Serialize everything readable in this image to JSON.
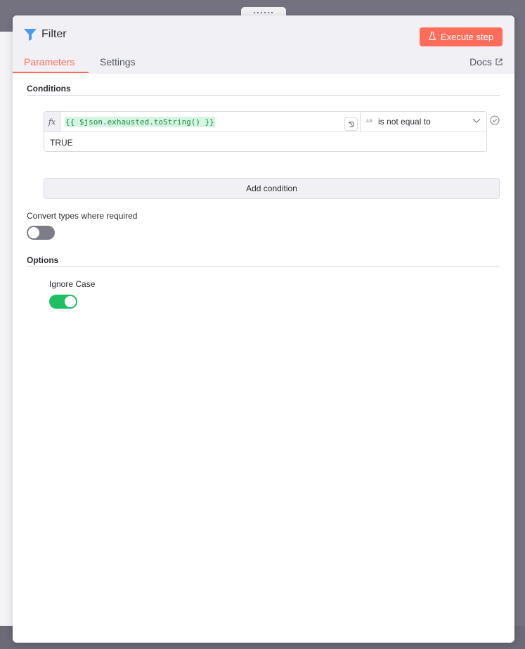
{
  "panel": {
    "title": "Filter",
    "execute_label": "Execute step",
    "tabs": [
      {
        "label": "Parameters",
        "active": true
      },
      {
        "label": "Settings",
        "active": false
      }
    ],
    "docs_label": "Docs"
  },
  "conditions": {
    "section_title": "Conditions",
    "items": [
      {
        "left_value": "{{ $json.exhausted.toString() }}",
        "type_badge": "AB",
        "operator": "is not equal to",
        "right_value": "TRUE"
      }
    ],
    "add_label": "Add condition"
  },
  "convert_types": {
    "label": "Convert types where required",
    "enabled": false
  },
  "options": {
    "section_title": "Options",
    "ignore_case": {
      "label": "Ignore Case",
      "enabled": true
    }
  },
  "colors": {
    "accent": "#ff6d5a",
    "toggle_on": "#1fc064",
    "toggle_off": "#7d7d87",
    "expression_bg": "#d5f5e2",
    "expression_text": "#1d8a47"
  },
  "icons": {
    "title": "funnel-icon",
    "execute": "flask-icon",
    "docs": "external-link-icon",
    "mapper": "mapping-icon",
    "operator_dropdown": "chevron-down-icon",
    "condition_status": "check-circle-icon"
  }
}
